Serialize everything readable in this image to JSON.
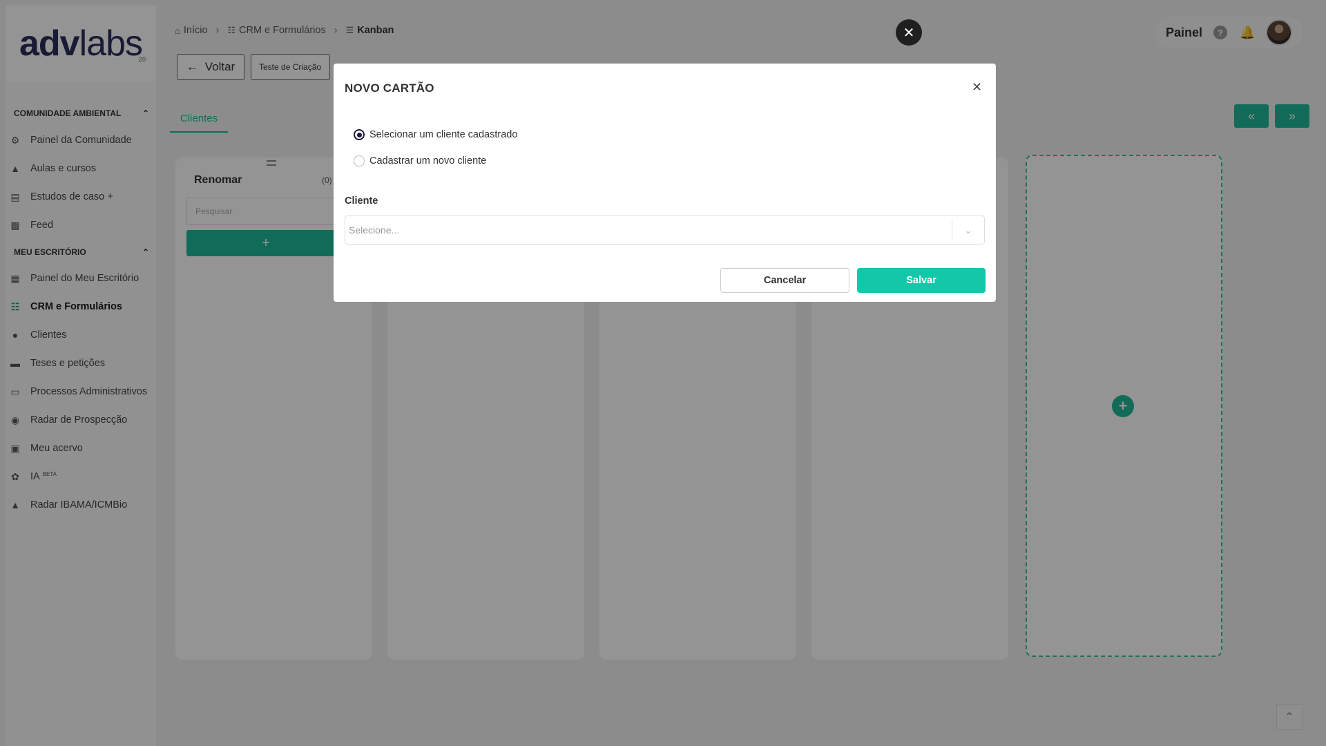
{
  "logo": {
    "text_a": "adv",
    "text_b": "labs",
    "version": "2.0"
  },
  "sidebar": {
    "section1": {
      "title": "Comunidade Ambiental"
    },
    "section1_items": [
      {
        "label": "Painel da Comunidade",
        "icon": "community-icon"
      },
      {
        "label": "Aulas e cursos",
        "icon": "graduation-cap-icon"
      },
      {
        "label": "Estudos de caso +",
        "icon": "book-icon"
      },
      {
        "label": "Feed",
        "icon": "chat-icon"
      }
    ],
    "section2": {
      "title": "Meu Escritório"
    },
    "section2_items": [
      {
        "label": "Painel do Meu Escritório",
        "icon": "building-icon"
      },
      {
        "label": "CRM e Formulários",
        "icon": "grid-icon"
      },
      {
        "label": "Clientes",
        "icon": "user-icon"
      },
      {
        "label": "Teses e petições",
        "icon": "folder-icon"
      },
      {
        "label": "Processos Administrativos",
        "icon": "inbox-icon"
      },
      {
        "label": "Radar de Prospecção",
        "icon": "location-pin-icon"
      },
      {
        "label": "Meu acervo",
        "icon": "archive-icon"
      },
      {
        "label": "IA",
        "badge": "BETA",
        "icon": "ai-icon"
      },
      {
        "label": "Radar IBAMA/ICMBio",
        "icon": "tree-icon"
      }
    ]
  },
  "breadcrumb": {
    "home": "Início",
    "crm": "CRM e Formulários",
    "current": "Kanban"
  },
  "toolbar": {
    "back_label": "Voltar",
    "board_select_value": "Teste de Criação"
  },
  "topbar": {
    "painel_label": "Painel"
  },
  "tabs": {
    "clientes": "Clientes"
  },
  "nav_arrows": {
    "prev": "«",
    "next": "»"
  },
  "columns": [
    {
      "title": "Renomar",
      "count": "(0)",
      "search_placeholder": "Pesquisar"
    }
  ],
  "modal": {
    "title": "NOVO CARTÃO",
    "options": [
      {
        "label": "Selecionar um cliente cadastrado",
        "selected": true
      },
      {
        "label": "Cadastrar um novo cliente",
        "selected": false
      }
    ],
    "client_label": "Cliente",
    "client_placeholder": "Selecione...",
    "cancel_label": "Cancelar",
    "save_label": "Salvar"
  },
  "colors": {
    "accent": "#1fb898",
    "save": "#15c7a9",
    "brand": "#2b2f5b"
  }
}
